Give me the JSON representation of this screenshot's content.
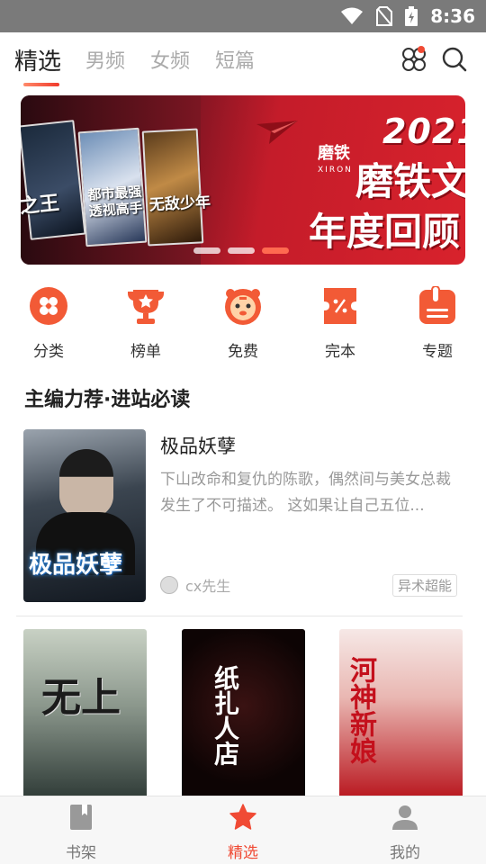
{
  "status_bar": {
    "time": "8:36"
  },
  "header": {
    "tabs": [
      {
        "label": "精选",
        "active": true
      },
      {
        "label": "男频",
        "active": false
      },
      {
        "label": "女频",
        "active": false
      },
      {
        "label": "短篇",
        "active": false
      }
    ],
    "icons": [
      "apps-icon",
      "search-icon"
    ]
  },
  "banner": {
    "brand": "磨铁",
    "brand_en": "XIRON",
    "year": "2021",
    "line1": "磨铁文",
    "line2": "年度回顾",
    "book_titles": [
      "之王",
      "都市最强透视高手",
      "无敌少年"
    ],
    "slides": 3,
    "active_slide": 3
  },
  "categories": [
    {
      "label": "分类",
      "icon": "category-icon"
    },
    {
      "label": "榜单",
      "icon": "trophy-icon"
    },
    {
      "label": "免费",
      "icon": "tiger-icon"
    },
    {
      "label": "完本",
      "icon": "ticket-icon"
    },
    {
      "label": "专题",
      "icon": "topic-icon"
    }
  ],
  "section": {
    "title": "主编力荐·进站必读",
    "featured": {
      "title": "极品妖孽",
      "cover_title": "极品妖孽",
      "description": "下山改命和复仇的陈歌，偶然间与美女总裁发生了不可描述。 这如果让自己五位...",
      "author": "cx先生",
      "tag": "异术超能"
    },
    "grid_covers": [
      {
        "cover_title": "无上"
      },
      {
        "cover_title": "纸扎人店"
      },
      {
        "cover_title": "河神新娘"
      }
    ]
  },
  "bottom_nav": [
    {
      "label": "书架",
      "icon": "bookshelf-icon",
      "active": false
    },
    {
      "label": "精选",
      "icon": "star-icon",
      "active": true
    },
    {
      "label": "我的",
      "icon": "profile-icon",
      "active": false
    }
  ],
  "colors": {
    "accent": "#f04a34",
    "banner_red": "#d8222c"
  }
}
